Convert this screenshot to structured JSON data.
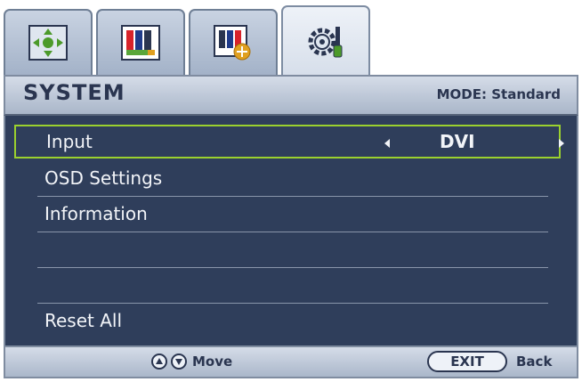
{
  "tabs": [
    {
      "icon": "move-arrows-icon"
    },
    {
      "icon": "color-bars-icon"
    },
    {
      "icon": "picture-advanced-icon"
    },
    {
      "icon": "system-gear-icon"
    }
  ],
  "header": {
    "title": "SYSTEM",
    "mode": "MODE: Standard"
  },
  "menu": {
    "items": [
      {
        "label": "Input",
        "value": "DVI"
      },
      {
        "label": "OSD Settings"
      },
      {
        "label": "Information"
      },
      {
        "label": ""
      },
      {
        "label": ""
      },
      {
        "label": "Reset All"
      }
    ]
  },
  "footer": {
    "move_label": "Move",
    "exit_label": "EXIT",
    "back_label": "Back"
  },
  "colors": {
    "panel": "#2f3e5b",
    "selection": "#9bd12e",
    "header": "#c2ccdb"
  }
}
